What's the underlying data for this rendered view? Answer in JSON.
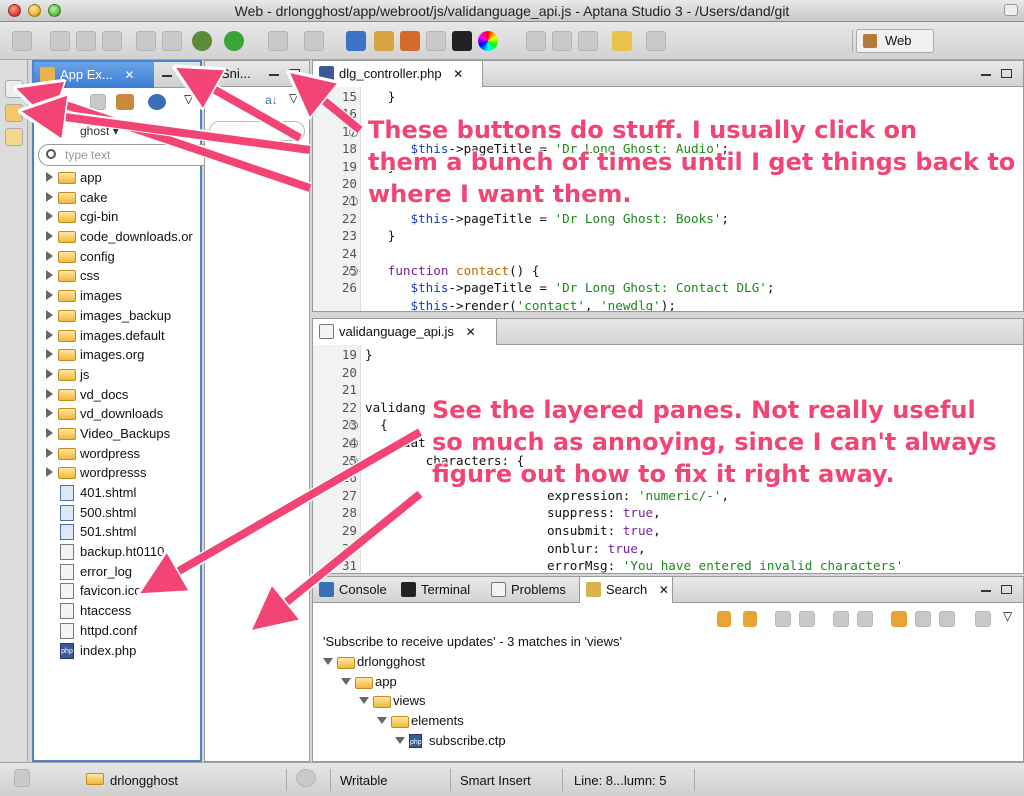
{
  "window": {
    "title": "Web - drlongghost/app/webroot/js/validanguage_api.js - Aptana Studio 3 - /Users/dand/git"
  },
  "toolbar": {
    "perspective_label": "Web"
  },
  "explorer": {
    "tabs": [
      "App Ex...",
      "Sni..."
    ],
    "project": "ghost",
    "search_placeholder": "type text",
    "items": [
      {
        "label": "app",
        "type": "folder"
      },
      {
        "label": "cake",
        "type": "folder"
      },
      {
        "label": "cgi-bin",
        "type": "folder"
      },
      {
        "label": "code_downloads.or",
        "type": "folder"
      },
      {
        "label": "config",
        "type": "folder"
      },
      {
        "label": "css",
        "type": "folder"
      },
      {
        "label": "images",
        "type": "folder"
      },
      {
        "label": "images_backup",
        "type": "folder"
      },
      {
        "label": "images.default",
        "type": "folder"
      },
      {
        "label": "images.org",
        "type": "folder"
      },
      {
        "label": "js",
        "type": "folder"
      },
      {
        "label": "vd_docs",
        "type": "folder"
      },
      {
        "label": "vd_downloads",
        "type": "folder"
      },
      {
        "label": "Video_Backups",
        "type": "folder"
      },
      {
        "label": "wordpress",
        "type": "folder"
      },
      {
        "label": "wordpresss",
        "type": "folder"
      },
      {
        "label": "401.shtml",
        "type": "html"
      },
      {
        "label": "500.shtml",
        "type": "html"
      },
      {
        "label": "501.shtml",
        "type": "html"
      },
      {
        "label": "backup.ht0110",
        "type": "file"
      },
      {
        "label": "error_log",
        "type": "file"
      },
      {
        "label": "favicon.ico",
        "type": "file"
      },
      {
        "label": "htaccess",
        "type": "file"
      },
      {
        "label": "httpd.conf",
        "type": "file"
      },
      {
        "label": "index.php",
        "type": "php"
      }
    ]
  },
  "editor1": {
    "tab": "dlg_controller.php",
    "lines": [
      {
        "n": "15",
        "t": "   }"
      },
      {
        "n": "16",
        "t": ""
      },
      {
        "n": "17",
        "t": ""
      },
      {
        "n": "18",
        "t": "      $this->pageTitle = 'Dr Long Ghost: Audio';"
      },
      {
        "n": "19",
        "t": "   }"
      },
      {
        "n": "20",
        "t": ""
      },
      {
        "n": "21",
        "t": ""
      },
      {
        "n": "22",
        "t": "      $this->pageTitle = 'Dr Long Ghost: Books';"
      },
      {
        "n": "23",
        "t": "   }"
      },
      {
        "n": "24",
        "t": ""
      },
      {
        "n": "25",
        "t": "   function contact() {"
      },
      {
        "n": "26",
        "t": "      $this->pageTitle = 'Dr Long Ghost: Contact DLG';"
      },
      {
        "n": "",
        "t": "      $this->render('contact', 'newdlg');"
      }
    ]
  },
  "editor2": {
    "tab": "validanguage_api.js",
    "lines": [
      {
        "n": "19",
        "t": "}"
      },
      {
        "n": "20",
        "t": ""
      },
      {
        "n": "21",
        "t": ""
      },
      {
        "n": "22",
        "t": "validang"
      },
      {
        "n": "23",
        "t": "  {"
      },
      {
        "n": "24",
        "t": "     dat"
      },
      {
        "n": "25",
        "t": "        characters: {"
      },
      {
        "n": "26",
        "t": ""
      },
      {
        "n": "27",
        "t": "                        expression: 'numeric/-',"
      },
      {
        "n": "28",
        "t": "                        suppress: true,"
      },
      {
        "n": "29",
        "t": "                        onsubmit: true,"
      },
      {
        "n": "30",
        "t": "                        onblur: true,"
      },
      {
        "n": "31",
        "t": "                        errorMsg: 'You have entered invalid characters'"
      }
    ]
  },
  "bottom_panel": {
    "tabs": [
      "Console",
      "Terminal",
      "Problems",
      "Search"
    ],
    "summary": "'Subscribe to receive updates' - 3 matches in 'views'",
    "tree": [
      {
        "label": "drlongghost",
        "depth": 0
      },
      {
        "label": "app",
        "depth": 1
      },
      {
        "label": "views",
        "depth": 2
      },
      {
        "label": "elements",
        "depth": 3
      },
      {
        "label": "subscribe.ctp",
        "depth": 4
      }
    ]
  },
  "statusbar": {
    "project": "drlongghost",
    "writable": "Writable",
    "insert_mode": "Smart Insert",
    "position": "Line: 8...lumn: 5"
  },
  "annotations": {
    "note1": [
      "These buttons do stuff. I usually click on",
      "them a bunch of times until I get things back to",
      "where I want them."
    ],
    "note2": [
      "See the layered panes. Not really useful",
      "so much as annoying, since I can't always",
      "figure out how to fix it right away."
    ]
  },
  "colors": {
    "annotation": "#f24576",
    "tab_active_blue": "#3a7dd6",
    "code_string": "#1a8a1a"
  }
}
